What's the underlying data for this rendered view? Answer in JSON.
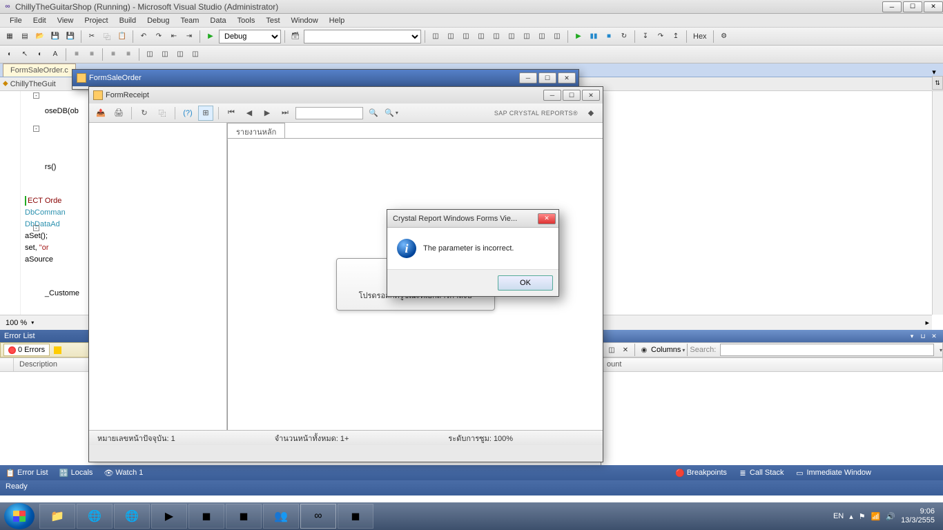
{
  "vs": {
    "title": "ChillyTheGuitarShop (Running) - Microsoft Visual Studio (Administrator)",
    "menu": [
      "File",
      "Edit",
      "View",
      "Project",
      "Build",
      "Debug",
      "Team",
      "Data",
      "Tools",
      "Test",
      "Window",
      "Help"
    ],
    "toolbar1": {
      "config": "Debug",
      "hex": "Hex"
    },
    "doc_tab": "FormSaleOrder.c",
    "nav_dropdown": "ChillyTheGuit",
    "code": {
      "lines": [
        {
          "t": "oseDB(ob",
          "outline": true
        },
        {
          "t": ""
        },
        {
          "t": ""
        },
        {
          "t": "rs()",
          "outline": true
        },
        {
          "t": ""
        },
        {
          "t": "ECT Orde",
          "cls": "fn"
        },
        {
          "t": "DbComman",
          "cls": "cls"
        },
        {
          "t": "DbDataAd",
          "cls": "cls"
        },
        {
          "t": "aSet();"
        },
        {
          "t": "set, \"or",
          "str": true
        },
        {
          "t": "aSource "
        },
        {
          "t": ""
        },
        {
          "t": "_Custome",
          "outline": true
        }
      ],
      "zoom": "100 %"
    },
    "error_panel": {
      "title": "Error List",
      "errors_tab": "0 Errors",
      "col_description": "Description",
      "col_count": "ount",
      "columns_label": "Columns",
      "search_label": "Search:"
    },
    "bottom_tabs": {
      "left": [
        "Error List",
        "Locals",
        "Watch 1"
      ],
      "right": [
        "Breakpoints",
        "Call Stack",
        "Immediate Window"
      ]
    },
    "status": "Ready"
  },
  "form_saleorder": {
    "title": "FormSaleOrder"
  },
  "form_receipt": {
    "title": "FormReceipt",
    "brand": "SAP CRYSTAL REPORTS®",
    "tab": "รายงานหลัก",
    "loading": "โปรดรอสักครู่ขณะที่เอกสารกำลังป",
    "status_current": "หมายเลขหน้าปัจจุบัน: 1",
    "status_total": "จำนวนหน้าทั้งหมด: 1+",
    "status_zoom": "ระดับการซูม: 100%"
  },
  "dialog": {
    "title": "Crystal Report Windows Forms Vie...",
    "message": "The parameter is incorrect.",
    "ok": "OK"
  },
  "taskbar": {
    "lang": "EN",
    "time": "9:06",
    "date": "13/3/2555"
  }
}
